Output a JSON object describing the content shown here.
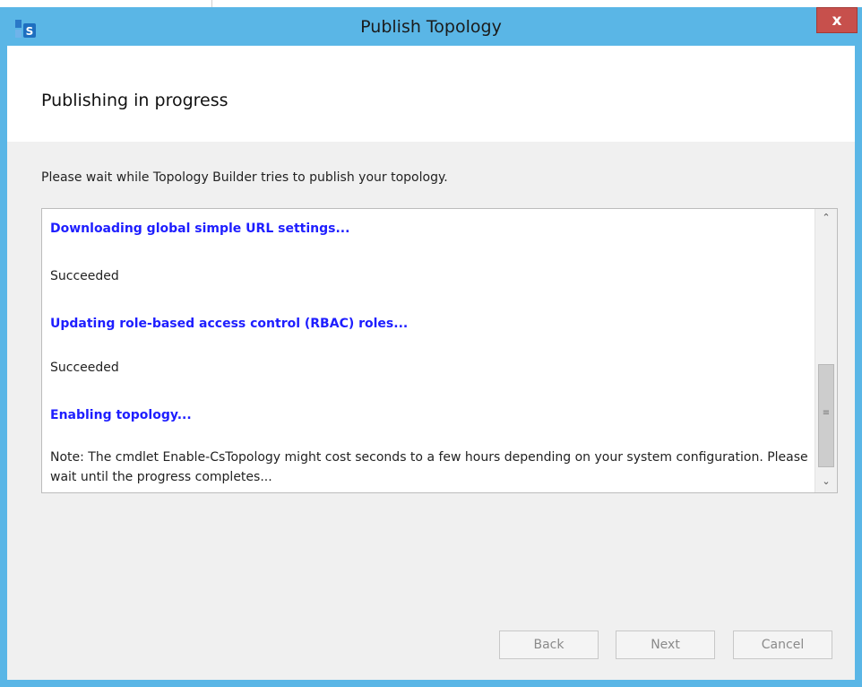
{
  "window": {
    "title": "Publish Topology",
    "close_label": "x"
  },
  "page": {
    "heading": "Publishing in progress",
    "instruction": "Please wait while Topology Builder tries to publish your topology."
  },
  "log": {
    "entries": [
      {
        "type": "action",
        "text": "Downloading global simple URL settings..."
      },
      {
        "type": "result",
        "text": "Succeeded"
      },
      {
        "type": "action",
        "text": "Updating role-based access control (RBAC) roles..."
      },
      {
        "type": "result",
        "text": "Succeeded"
      },
      {
        "type": "action",
        "text": "Enabling topology..."
      },
      {
        "type": "note",
        "text": "Note: The cmdlet Enable-CsTopology might cost seconds to a few hours depending on your system configuration. Please wait until the progress completes..."
      }
    ]
  },
  "buttons": {
    "back": "Back",
    "next": "Next",
    "cancel": "Cancel"
  },
  "colors": {
    "window_frame": "#5ab6e6",
    "action_text": "#1e1eff",
    "close_button": "#c7504c"
  }
}
